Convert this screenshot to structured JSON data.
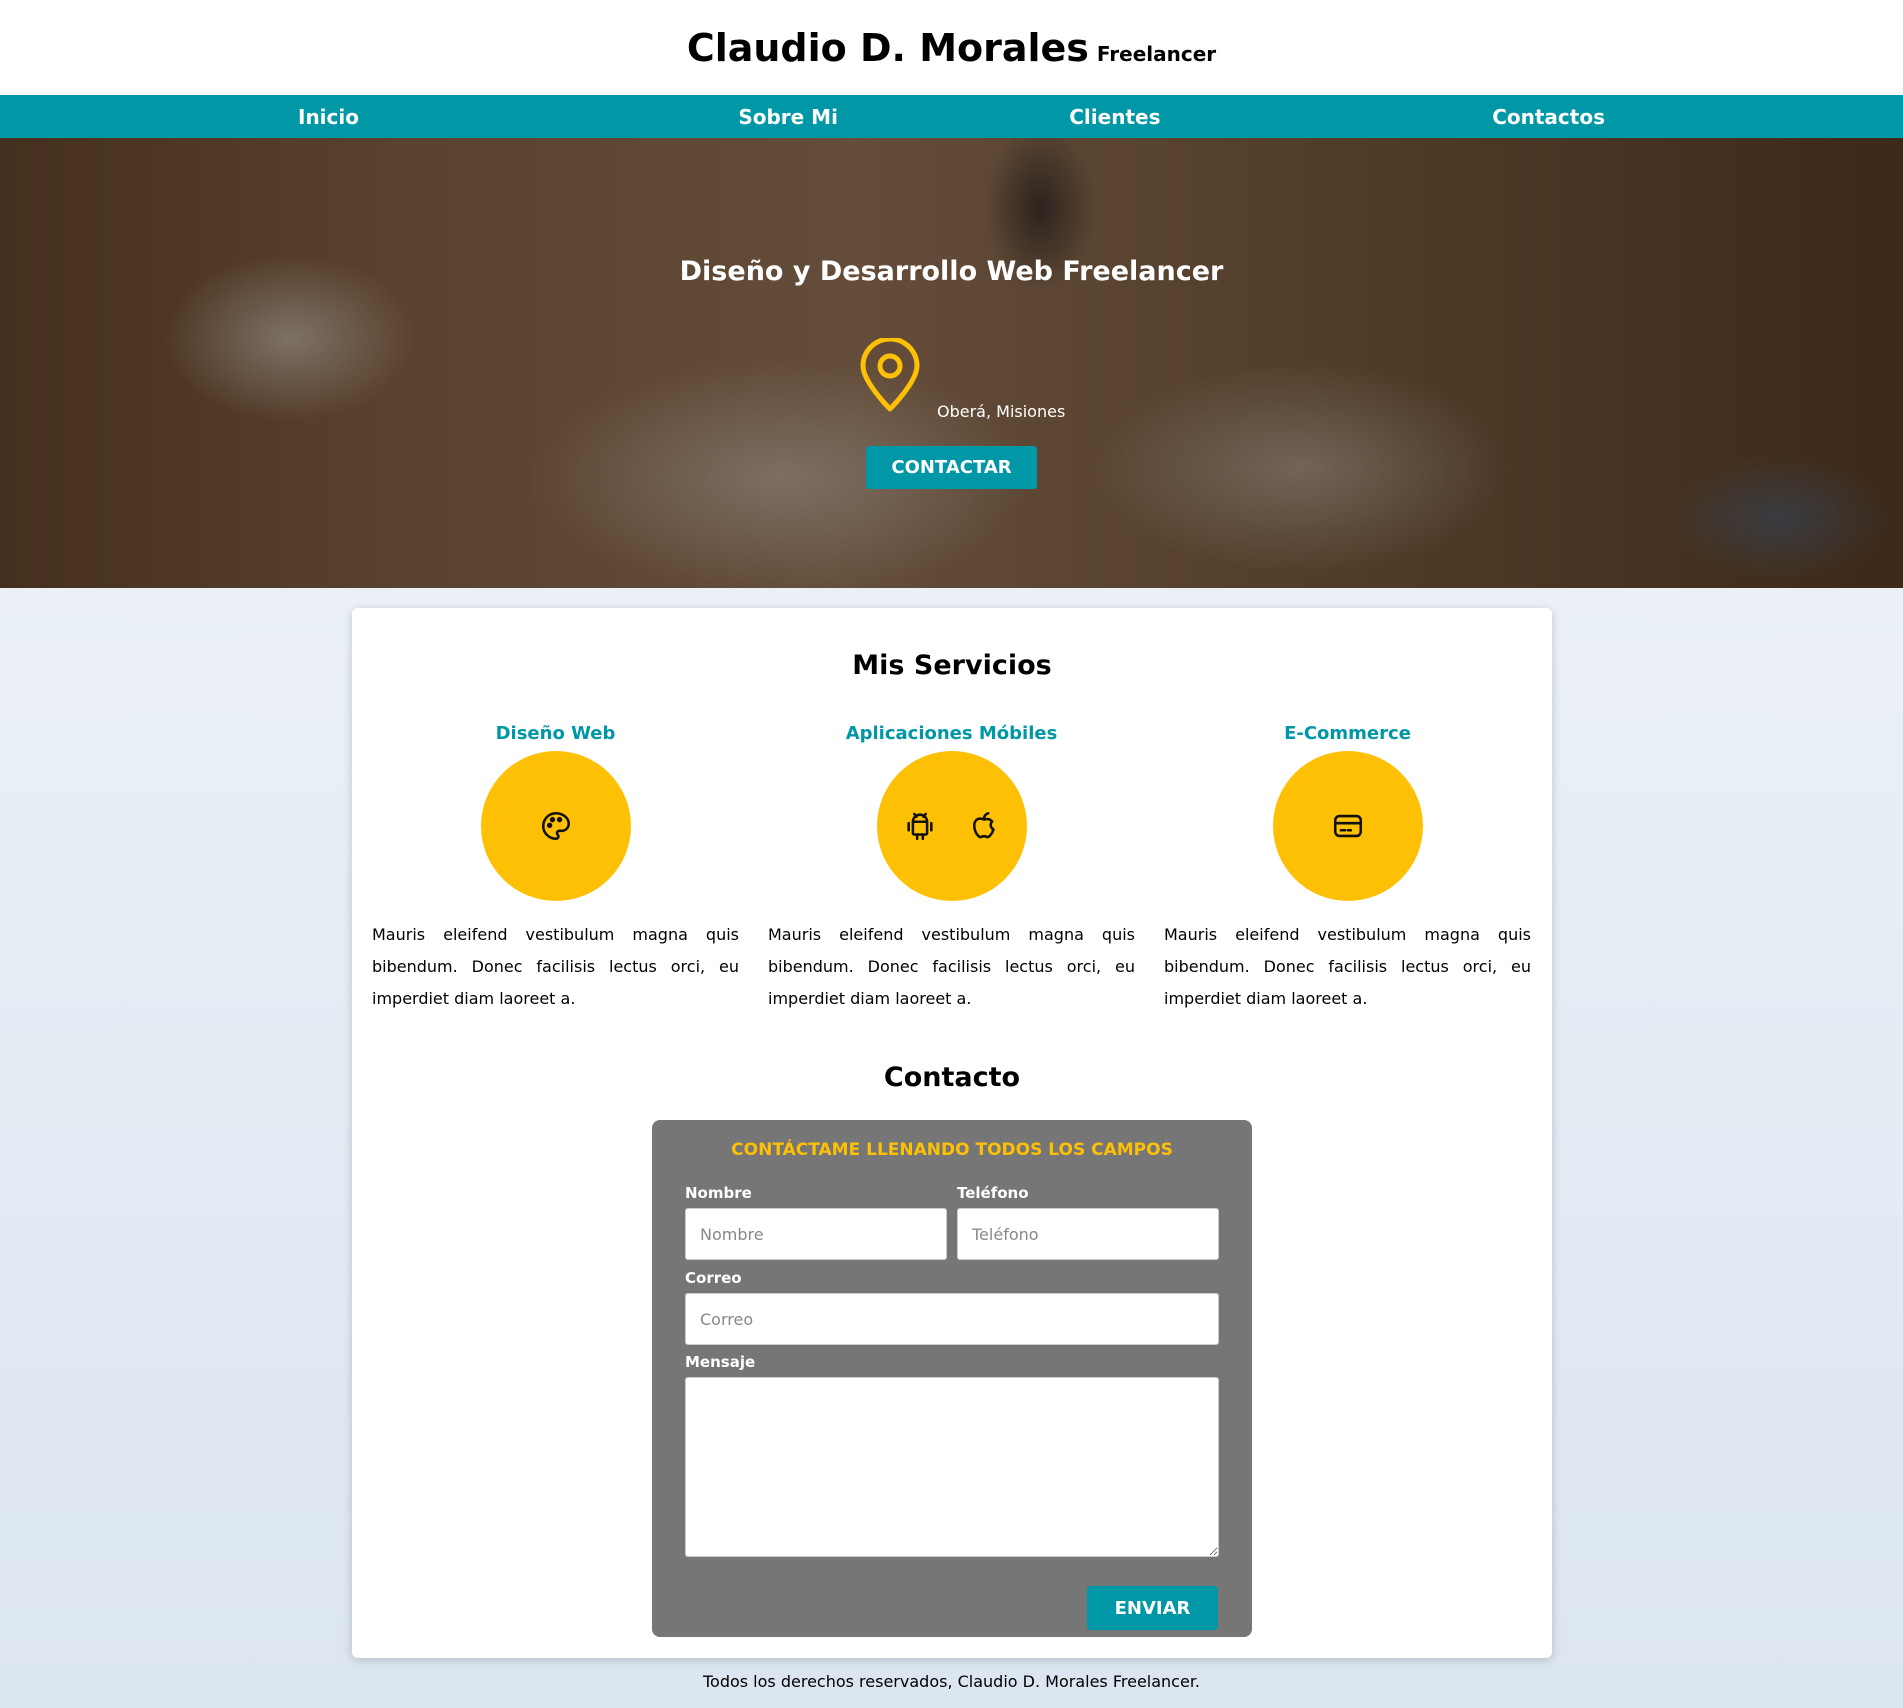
{
  "header": {
    "name": "Claudio D. Morales",
    "tagline": "Freelancer"
  },
  "nav": {
    "items": [
      "Inicio",
      "Sobre Mi",
      "Clientes",
      "Contactos"
    ]
  },
  "hero": {
    "title": "Diseño y Desarrollo Web Freelancer",
    "location": "Oberá, Misiones",
    "cta": "CONTACTAR",
    "icon": "map-pin-icon",
    "icon_color": "#fdc005"
  },
  "services": {
    "title": "Mis Servicios",
    "items": [
      {
        "title": "Diseño Web",
        "icons": [
          "palette-icon"
        ],
        "text": "Mauris eleifend vestibulum magna quis bibendum. Donec facilisis lectus orci, eu imperdiet diam laoreet a."
      },
      {
        "title": "Aplicaciones Móbiles",
        "icons": [
          "android-icon",
          "apple-icon"
        ],
        "text": "Mauris eleifend vestibulum magna quis bibendum. Donec facilisis lectus orci, eu imperdiet diam laoreet a."
      },
      {
        "title": "E-Commerce",
        "icons": [
          "credit-card-icon"
        ],
        "text": "Mauris eleifend vestibulum magna quis bibendum. Donec facilisis lectus orci, eu imperdiet diam laoreet a."
      }
    ]
  },
  "contact": {
    "title": "Contacto",
    "heading": "CONTÁCTAME LLENANDO TODOS LOS CAMPOS",
    "name_label": "Nombre",
    "name_placeholder": "Nombre",
    "phone_label": "Teléfono",
    "phone_placeholder": "Teléfono",
    "email_label": "Correo",
    "email_placeholder": "Correo",
    "message_label": "Mensaje",
    "submit": "ENVIAR"
  },
  "footer": {
    "text": "Todos los derechos reservados, Claudio D. Morales Freelancer."
  },
  "colors": {
    "accent": "#0097a6",
    "highlight": "#fdc005",
    "form_bg": "#767676"
  }
}
